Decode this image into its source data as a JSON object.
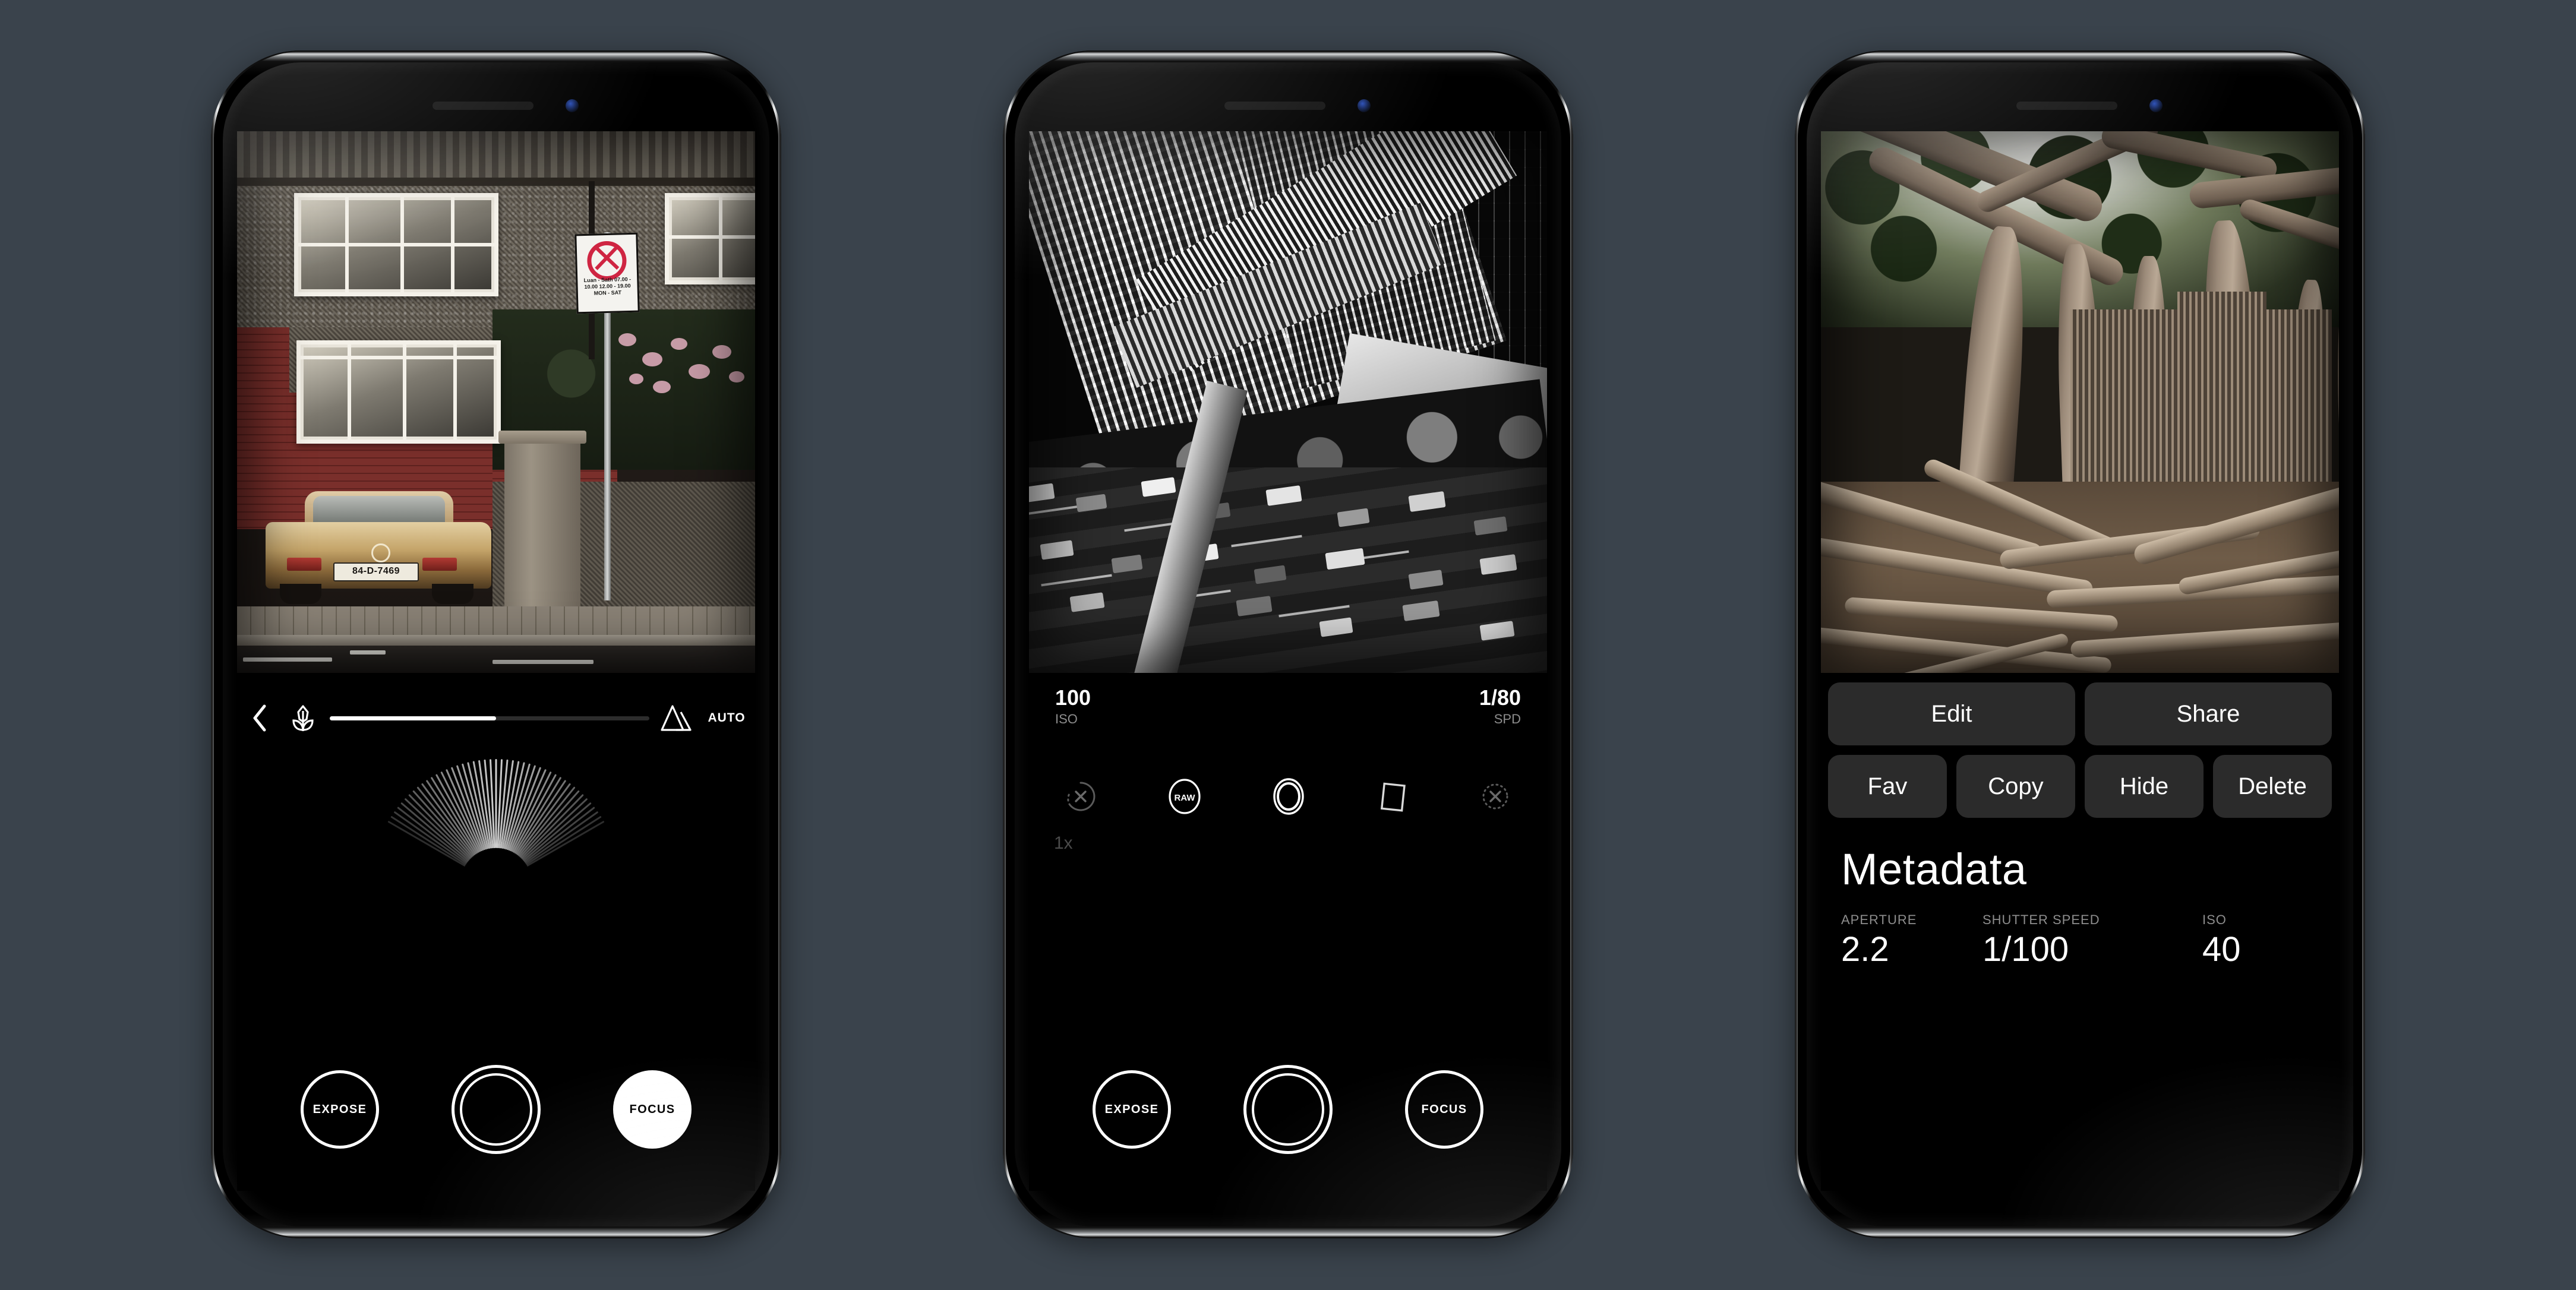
{
  "background_color": "#3a434c",
  "phones": [
    {
      "id": "phone-camera-focus",
      "screen_mode": "camera-manual-focus",
      "photo": {
        "name": "red-brick-house-with-vintage-car",
        "description": "Terraced red brick house with bay windows, a gold vintage Mercedes parked outside, a no-waiting road sign and magnolia blossom",
        "car_plate": "84-D-7469",
        "sign_text": "Luan - Sath\n07.00 - 10.00\n12.00 - 19.00\nMON - SAT"
      },
      "controls": {
        "back_icon": "chevron-left-icon",
        "macro_icon": "flower-icon",
        "landscape_icon": "mountain-icon",
        "focus_slider_percent": 52,
        "auto_label": "AUTO",
        "buttons": [
          {
            "label": "EXPOSE",
            "style": "outline"
          },
          {
            "label": "",
            "style": "shutter"
          },
          {
            "label": "FOCUS",
            "style": "filled"
          }
        ]
      }
    },
    {
      "id": "phone-camera-exposure",
      "screen_mode": "camera-manual-exposure",
      "photo": {
        "name": "aerial-black-and-white-city",
        "description": "Tilted black and white aerial view of highrise towers, a pedestrian bridge, trees and a traffic-filled multi-lane road"
      },
      "readouts": [
        {
          "value": "100",
          "key": "ISO"
        },
        {
          "value": "1/80",
          "key": "SPD"
        }
      ],
      "icons": [
        {
          "name": "timer-off-icon",
          "state": "off"
        },
        {
          "name": "raw-icon",
          "label": "RAW",
          "state": "on"
        },
        {
          "name": "aperture-icon",
          "state": "on"
        },
        {
          "name": "frame-format-icon",
          "state": "on"
        },
        {
          "name": "flash-off-icon",
          "state": "off"
        }
      ],
      "zoom_label": "1x",
      "buttons": [
        {
          "label": "EXPOSE",
          "style": "outline"
        },
        {
          "label": "",
          "style": "shutter"
        },
        {
          "label": "FOCUS",
          "style": "outline"
        }
      ]
    },
    {
      "id": "phone-library-detail",
      "screen_mode": "photo-detail",
      "photo": {
        "name": "banyan-tree-roots",
        "description": "Large banyan fig tree with sprawling surface roots and aerial root curtains under a green canopy"
      },
      "actions_primary": [
        "Edit",
        "Share"
      ],
      "actions_secondary": [
        "Fav",
        "Copy",
        "Hide",
        "Delete"
      ],
      "metadata": {
        "title": "Metadata",
        "fields": [
          {
            "key": "APERTURE",
            "value": "2.2"
          },
          {
            "key": "SHUTTER SPEED",
            "value": "1/100"
          },
          {
            "key": "ISO",
            "value": "40"
          }
        ]
      }
    }
  ]
}
